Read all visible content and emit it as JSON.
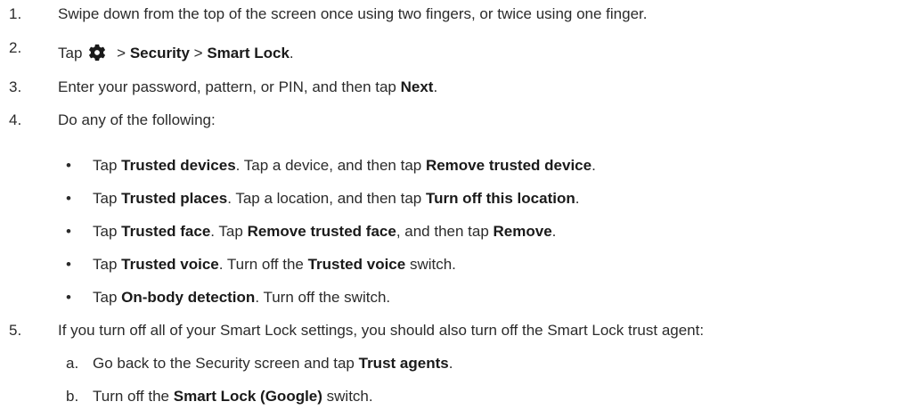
{
  "steps": [
    {
      "num": "1.",
      "text": "Swipe down from the top of the screen once using two fingers, or twice using one finger."
    },
    {
      "num": "2.",
      "pre": "Tap",
      "sep1": ">",
      "b1": "Security",
      "sep2": ">",
      "b2": "Smart Lock",
      "end": "."
    },
    {
      "num": "3.",
      "pre": "Enter your password, pattern, or PIN, and then tap ",
      "b1": "Next",
      "end": "."
    },
    {
      "num": "4.",
      "text": "Do any of the following:"
    },
    {
      "num": "5.",
      "text": "If you turn off all of your Smart Lock settings, you should also turn off the Smart Lock trust agent:"
    }
  ],
  "bullet_symbol": "•",
  "bullets": [
    {
      "pre": "Tap ",
      "b1": "Trusted devices",
      "mid": ". Tap a device, and then tap ",
      "b2": "Remove trusted device",
      "end": "."
    },
    {
      "pre": "Tap ",
      "b1": "Trusted places",
      "mid": ". Tap a location, and then tap ",
      "b2": "Turn off this location",
      "end": "."
    },
    {
      "pre": "Tap ",
      "b1": "Trusted face",
      "mid": ". Tap ",
      "b2": "Remove trusted face",
      "mid2": ", and then tap ",
      "b3": "Remove",
      "end": "."
    },
    {
      "pre": "Tap ",
      "b1": "Trusted voice",
      "mid": ". Turn off the ",
      "b2": "Trusted voice",
      "end": " switch."
    },
    {
      "pre": "Tap ",
      "b1": "On-body detection",
      "mid": ". Turn off the switch."
    }
  ],
  "substeps": [
    {
      "letter": "a.",
      "pre": "Go back to the Security screen and tap ",
      "b1": "Trust agents",
      "end": "."
    },
    {
      "letter": "b.",
      "pre": "Turn off the ",
      "b1": "Smart Lock (Google)",
      "end": " switch."
    }
  ],
  "icon": "gear-icon"
}
